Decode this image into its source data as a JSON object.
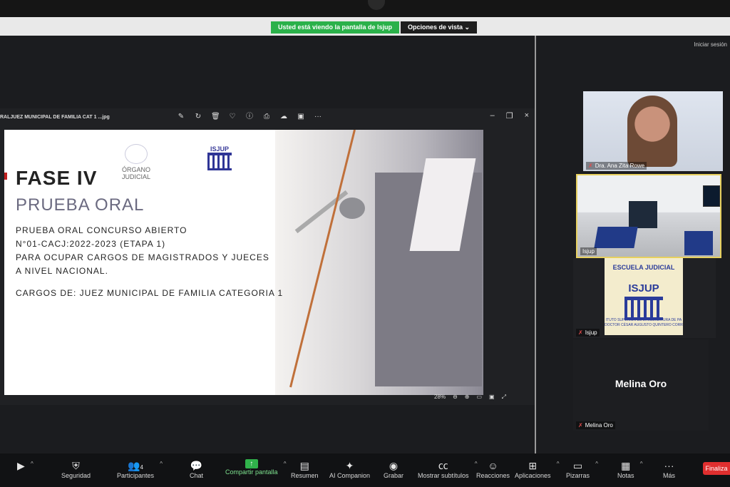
{
  "banner": {
    "viewing_text": "Usted está viendo la pantalla de Isjup",
    "view_options": "Opciones de vista"
  },
  "top_right": {
    "signin": "Iniciar sesión"
  },
  "viewer": {
    "title": "RALJUEZ MUNICIPAL DE FAMILIA CAT 1 ...jpg",
    "tools": [
      "edit-icon",
      "rotate-icon",
      "trash-icon",
      "heart-icon",
      "info-icon",
      "print-icon",
      "cloud-icon",
      "folder-icon",
      "more-icon"
    ],
    "window_controls": {
      "minimize": "–",
      "restore": "❐",
      "close": "×"
    },
    "zoom_level": "28%"
  },
  "slide": {
    "logo1_text": "ÓRGANO\nJUDICIAL",
    "logo2_text": "ISJUP",
    "heading": "FASE IV",
    "subheading": "PRUEBA ORAL",
    "body_lines": [
      "PRUEBA ORAL CONCURSO ABIERTO",
      "N°01-CACJ:2022-2023 (ETAPA 1)",
      "PARA OCUPAR CARGOS DE MAGISTRADOS Y JUECES",
      "A NIVEL NACIONAL."
    ],
    "cargos": "CARGOS DE: JUEZ MUNICIPAL DE FAMILIA CATEGORIA 1"
  },
  "participants": {
    "tile1_name": "Dra. Ana Zita Rowe",
    "tile2_name": "Isjup",
    "tile3_name": "Isjup",
    "tile4_name": "Melina Oro",
    "tile4_big": "Melina Oro",
    "escuela": {
      "top": "ESCUELA JUDICIAL",
      "name": "ISJUP",
      "sub": "ITUTO SUPERIOR DE LA JUDICATURA DE PA\nDOCTOR CÉSAR AUGUSTO QUINTERO CORR"
    }
  },
  "toolbar": {
    "video": "",
    "security": "Seguridad",
    "participants": "Participantes",
    "participants_count": "4",
    "chat": "Chat",
    "share": "Compartir pantalla",
    "summary": "Resumen",
    "companion": "AI Companion",
    "record": "Grabar",
    "subtitles": "Mostrar subtítulos",
    "reactions": "Reacciones",
    "apps": "Aplicaciones",
    "whiteboards": "Pizarras",
    "notes": "Notas",
    "more": "Más",
    "end": "Finaliza"
  }
}
